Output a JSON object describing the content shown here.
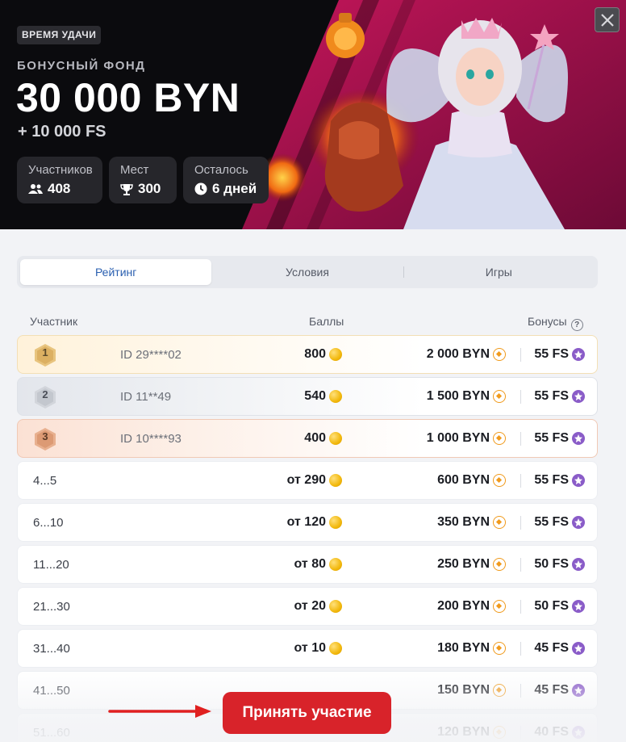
{
  "hero": {
    "badge": "ВРЕМЯ УДАЧИ",
    "subtitle": "БОНУСНЫЙ ФОНД",
    "amount": "30 000 BYN",
    "extra": "+ 10 000 FS",
    "stats": [
      {
        "label": "Участников",
        "value": "408",
        "icon": "users-icon"
      },
      {
        "label": "Мест",
        "value": "300",
        "icon": "trophy-icon"
      },
      {
        "label": "Осталось",
        "value": "6 дней",
        "icon": "clock-icon"
      }
    ]
  },
  "tabs": [
    {
      "label": "Рейтинг",
      "active": true
    },
    {
      "label": "Условия",
      "active": false
    },
    {
      "label": "Игры",
      "active": false
    }
  ],
  "table": {
    "headers": {
      "participant": "Участник",
      "points": "Баллы",
      "bonuses": "Бонусы"
    },
    "rows": [
      {
        "place": "1",
        "id": "ID 29****02",
        "points": "800",
        "prize": "2 000 BYN",
        "fs": "55 FS"
      },
      {
        "place": "2",
        "id": "ID 11**49",
        "points": "540",
        "prize": "1 500 BYN",
        "fs": "55 FS"
      },
      {
        "place": "3",
        "id": "ID 10****93",
        "points": "400",
        "prize": "1 000 BYN",
        "fs": "55 FS"
      },
      {
        "range": "4...5",
        "points": "от 290",
        "prize": "600 BYN",
        "fs": "55 FS"
      },
      {
        "range": "6...10",
        "points": "от 120",
        "prize": "350 BYN",
        "fs": "55 FS"
      },
      {
        "range": "11...20",
        "points": "от 80",
        "prize": "250 BYN",
        "fs": "50 FS"
      },
      {
        "range": "21...30",
        "points": "от 20",
        "prize": "200 BYN",
        "fs": "50 FS"
      },
      {
        "range": "31...40",
        "points": "от 10",
        "prize": "180 BYN",
        "fs": "45 FS"
      },
      {
        "range": "41...50",
        "points": "",
        "prize": "150 BYN",
        "fs": "45 FS"
      },
      {
        "range": "51...60",
        "points": "",
        "prize": "120 BYN",
        "fs": "40 FS"
      }
    ]
  },
  "cta": {
    "label": "Принять участие"
  },
  "colors": {
    "accent": "#d8232a",
    "tab_active": "#2a5fb0",
    "gold": "#f2b80c",
    "fs_purple": "#8a5cc8"
  }
}
